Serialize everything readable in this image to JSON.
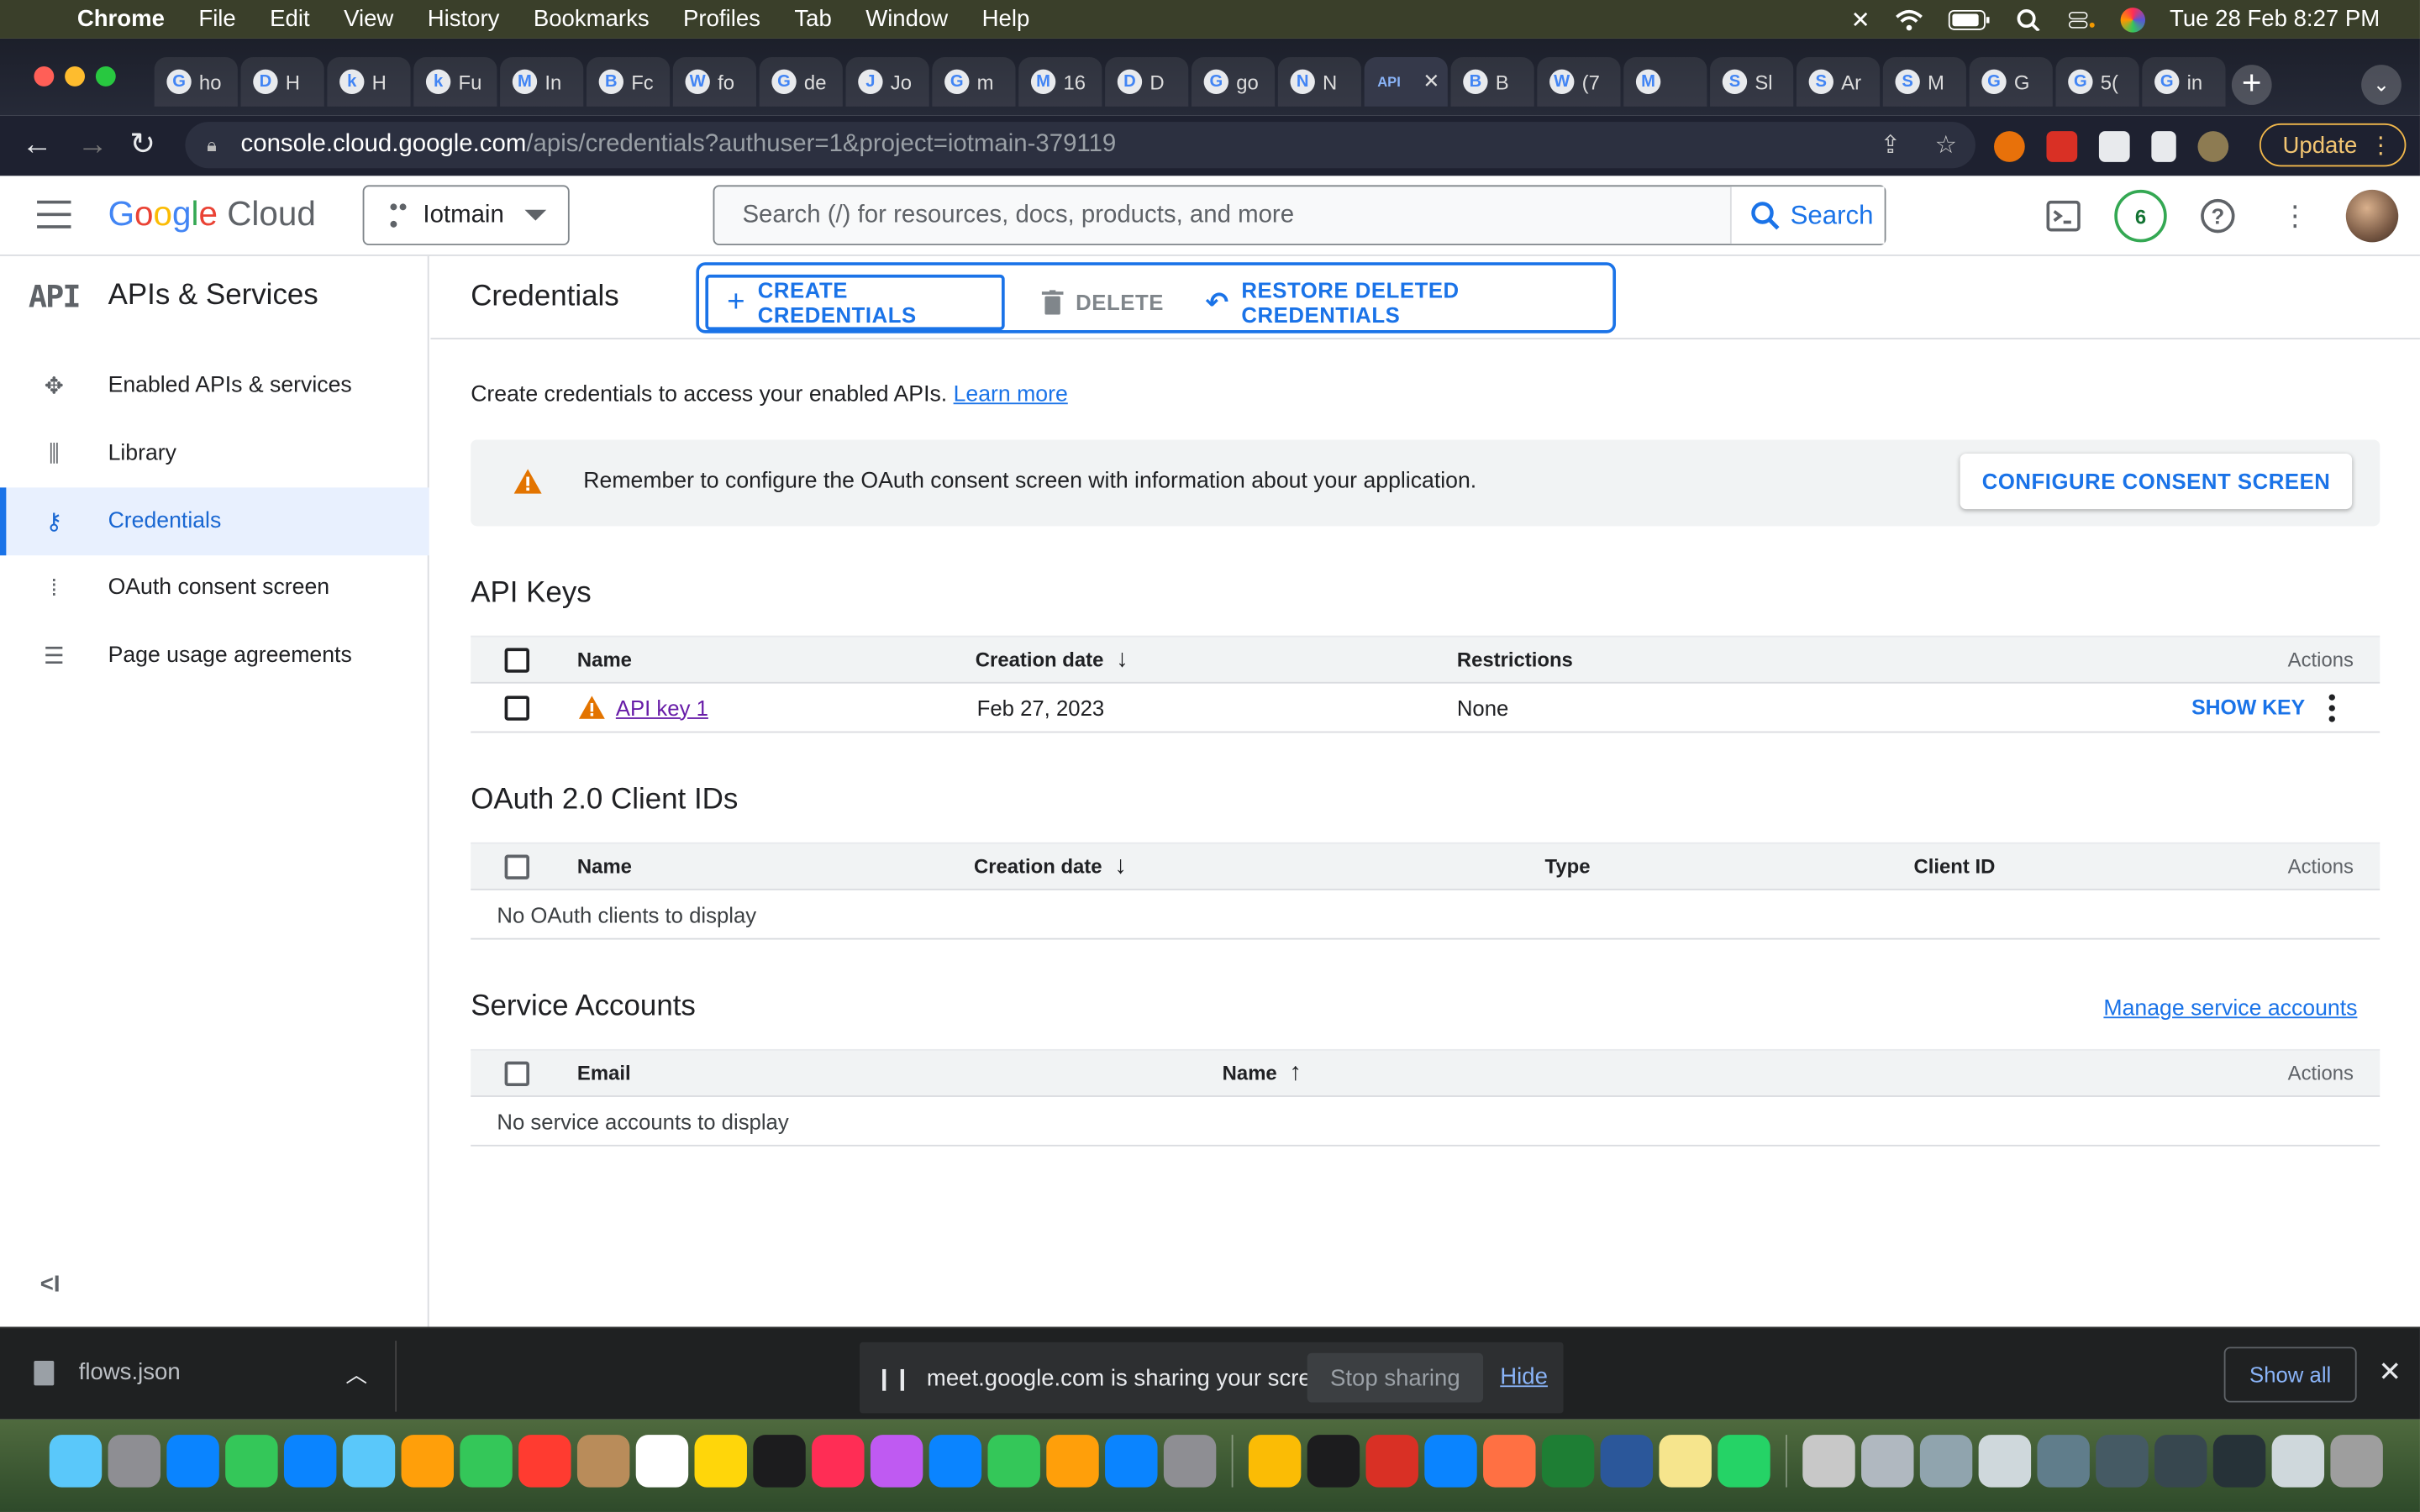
{
  "menubar": {
    "app": "Chrome",
    "items": [
      "File",
      "Edit",
      "View",
      "History",
      "Bookmarks",
      "Profiles",
      "Tab",
      "Window",
      "Help"
    ],
    "clock": "Tue 28 Feb  8:27 PM"
  },
  "browser": {
    "tabs": [
      {
        "title": "ho",
        "icon": "G"
      },
      {
        "title": "H",
        "icon": "D"
      },
      {
        "title": "H",
        "icon": "k"
      },
      {
        "title": "Fu",
        "icon": "k"
      },
      {
        "title": "In",
        "icon": "M"
      },
      {
        "title": "Fc",
        "icon": "B"
      },
      {
        "title": "fo",
        "icon": "W"
      },
      {
        "title": "de",
        "icon": "G"
      },
      {
        "title": "Jo",
        "icon": "J"
      },
      {
        "title": "m",
        "icon": "G"
      },
      {
        "title": "16",
        "icon": "M"
      },
      {
        "title": "D",
        "icon": "D"
      },
      {
        "title": "go",
        "icon": "G"
      },
      {
        "title": "N",
        "icon": "N"
      },
      {
        "title": "",
        "icon": "API",
        "active": true
      },
      {
        "title": "B",
        "icon": "B"
      },
      {
        "title": "(7",
        "icon": "W"
      },
      {
        "title": "",
        "icon": "M"
      },
      {
        "title": "Sl",
        "icon": "S"
      },
      {
        "title": "Ar",
        "icon": "S"
      },
      {
        "title": "M",
        "icon": "S"
      },
      {
        "title": "G",
        "icon": "G"
      },
      {
        "title": "5(",
        "icon": "G"
      },
      {
        "title": "in",
        "icon": "G"
      }
    ],
    "url_host": "console.cloud.google.com",
    "url_path": "/apis/credentials?authuser=1&project=iotmain-379119",
    "update_label": "Update"
  },
  "gcp": {
    "logo_google": [
      "G",
      "o",
      "o",
      "g",
      "l",
      "e"
    ],
    "logo_cloud": "Cloud",
    "project": "Iotmain",
    "search_placeholder": "Search (/) for resources, docs, products, and more",
    "search_button": "Search",
    "notification_count": "6"
  },
  "sidebar": {
    "title": "APIs & Services",
    "logo": "API",
    "items": [
      {
        "label": "Enabled APIs & services",
        "icon": "✥"
      },
      {
        "label": "Library",
        "icon": "⫼"
      },
      {
        "label": "Credentials",
        "icon": "⚷",
        "active": true
      },
      {
        "label": "OAuth consent screen",
        "icon": "⁞"
      },
      {
        "label": "Page usage agreements",
        "icon": "☰"
      }
    ]
  },
  "main": {
    "title": "Credentials",
    "create_label": "CREATE CREDENTIALS",
    "delete_label": "DELETE",
    "restore_label": "RESTORE DELETED CREDENTIALS",
    "intro": "Create credentials to access your enabled APIs.",
    "learn_more": "Learn more",
    "banner_msg": "Remember to configure the OAuth consent screen with information about your application.",
    "banner_btn": "CONFIGURE CONSENT SCREEN",
    "api_keys": {
      "title": "API Keys",
      "columns": [
        "Name",
        "Creation date",
        "Restrictions",
        "Actions"
      ],
      "rows": [
        {
          "name": "API key 1",
          "date": "Feb 27, 2023",
          "restrictions": "None",
          "action": "SHOW KEY"
        }
      ]
    },
    "oauth": {
      "title": "OAuth 2.0 Client IDs",
      "columns": [
        "Name",
        "Creation date",
        "Type",
        "Client ID",
        "Actions"
      ],
      "empty": "No OAuth clients to display"
    },
    "service": {
      "title": "Service Accounts",
      "manage_link": "Manage service accounts",
      "columns": [
        "Email",
        "Name",
        "Actions"
      ],
      "empty": "No service accounts to display"
    }
  },
  "downloads": {
    "file": "flows.json",
    "share_msg": "meet.google.com is sharing your screen.",
    "stop": "Stop sharing",
    "hide": "Hide",
    "show_all": "Show all"
  },
  "colors": {
    "accent": "#1a73e8",
    "warning": "#e37400"
  }
}
